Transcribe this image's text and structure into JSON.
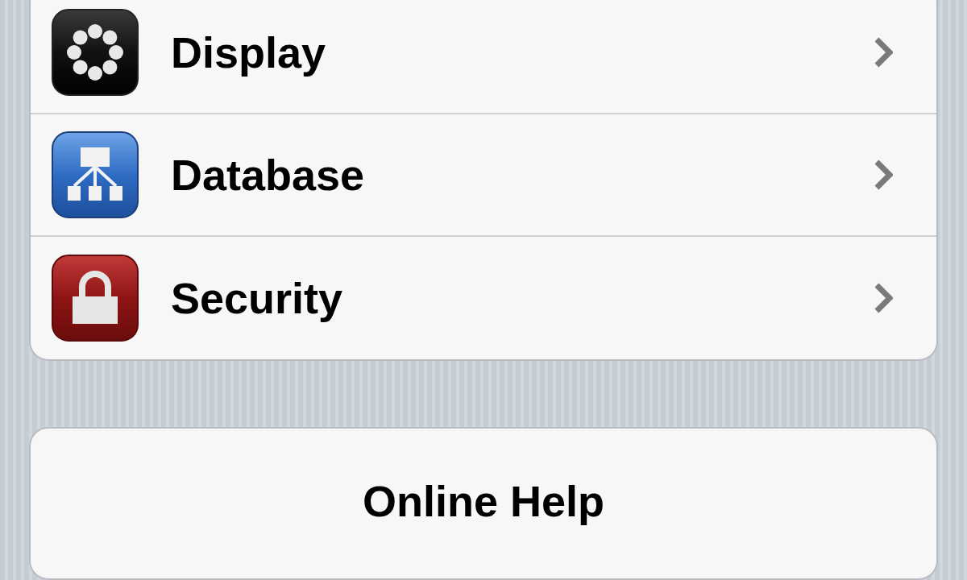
{
  "settings_group": {
    "rows": [
      {
        "label": "Display"
      },
      {
        "label": "Database"
      },
      {
        "label": "Security"
      }
    ]
  },
  "help_button": {
    "label": "Online Help"
  }
}
